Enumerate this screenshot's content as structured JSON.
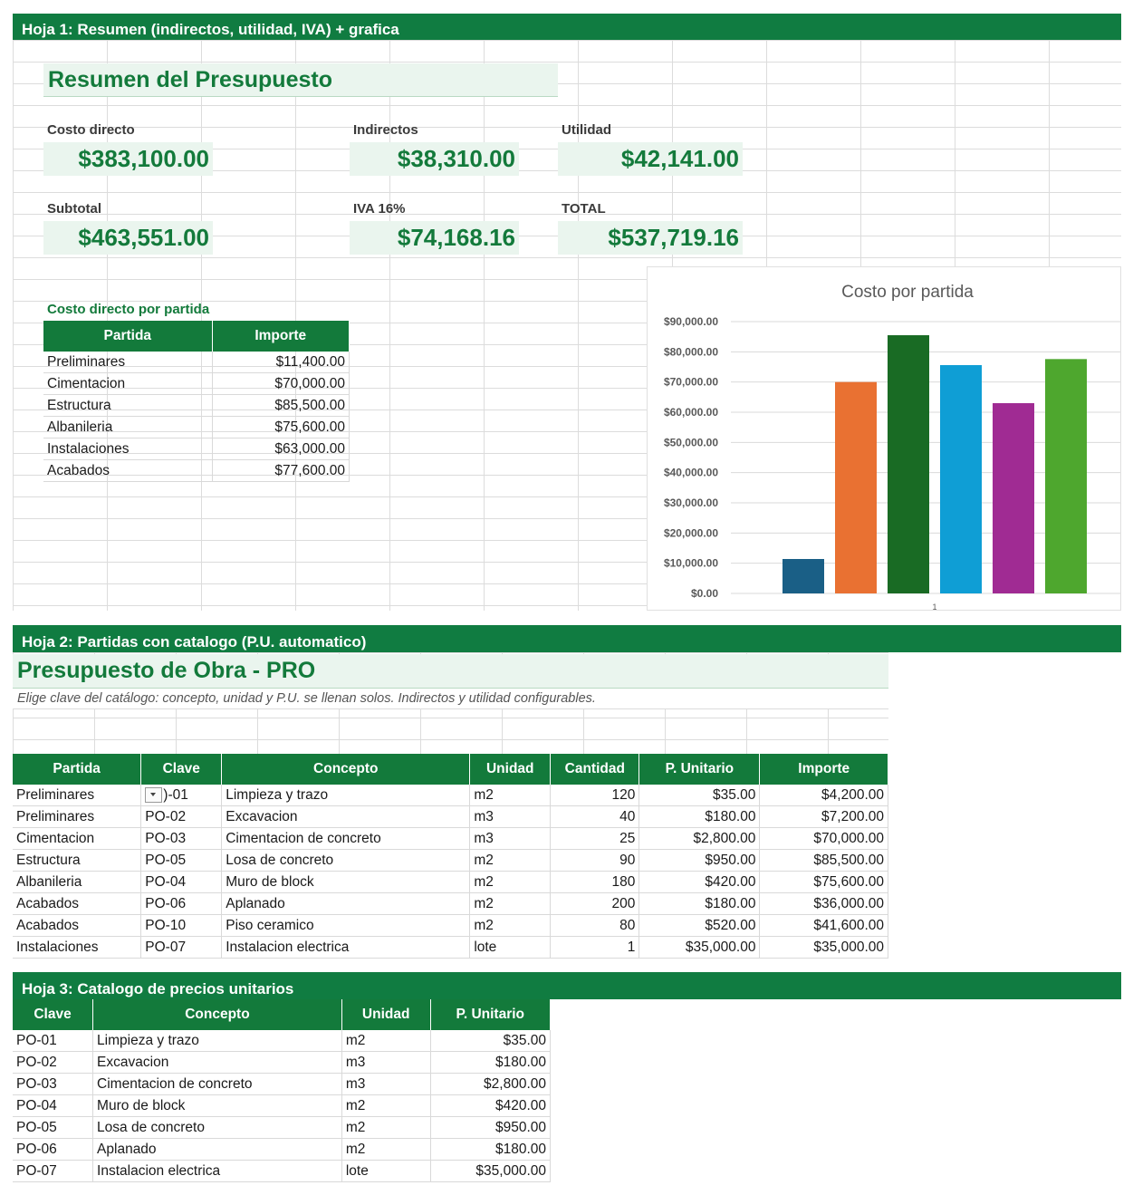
{
  "sheet1": {
    "band": "Hoja 1: Resumen (indirectos, utilidad, IVA) + grafica",
    "title": "Resumen del Presupuesto",
    "cards": [
      {
        "label": "Costo directo",
        "value": "$383,100.00"
      },
      {
        "label": "Indirectos",
        "value": "$38,310.00"
      },
      {
        "label": "Utilidad",
        "value": "$42,141.00"
      },
      {
        "label": "Subtotal",
        "value": "$463,551.00"
      },
      {
        "label": "IVA 16%",
        "value": "$74,168.16"
      },
      {
        "label": "TOTAL",
        "value": "$537,719.16"
      }
    ],
    "partida_title": "Costo directo por partida",
    "partida_headers": [
      "Partida",
      "Importe"
    ],
    "partidas": [
      [
        "Preliminares",
        "$11,400.00"
      ],
      [
        "Cimentacion",
        "$70,000.00"
      ],
      [
        "Estructura",
        "$85,500.00"
      ],
      [
        "Albanileria",
        "$75,600.00"
      ],
      [
        "Instalaciones",
        "$63,000.00"
      ],
      [
        "Acabados",
        "$77,600.00"
      ]
    ]
  },
  "chart_data": {
    "type": "bar",
    "title": "Costo por partida",
    "categories": [
      "1"
    ],
    "series": [
      {
        "values": [
          11400
        ],
        "color": "#1a5f86"
      },
      {
        "values": [
          70000
        ],
        "color": "#e97132"
      },
      {
        "values": [
          85500
        ],
        "color": "#196b24"
      },
      {
        "values": [
          75600
        ],
        "color": "#0f9ed5"
      },
      {
        "values": [
          63000
        ],
        "color": "#a02b93"
      },
      {
        "values": [
          77600
        ],
        "color": "#4ea72e"
      }
    ],
    "ylim": [
      0,
      90000
    ],
    "yticks": [
      "$0.00",
      "$10,000.00",
      "$20,000.00",
      "$30,000.00",
      "$40,000.00",
      "$50,000.00",
      "$60,000.00",
      "$70,000.00",
      "$80,000.00",
      "$90,000.00"
    ],
    "grid": true
  },
  "sheet2": {
    "band": "Hoja 2: Partidas con catalogo (P.U. automatico)",
    "title": "Presupuesto de Obra - PRO",
    "subtitle": "Elige clave del catálogo: concepto, unidad y P.U. se llenan solos. Indirectos y utilidad configurables.",
    "headers": [
      "Partida",
      "Clave",
      "Concepto",
      "Unidad",
      "Cantidad",
      "P. Unitario",
      "Importe"
    ],
    "rows": [
      [
        "Preliminares",
        ")-01",
        "Limpieza y trazo",
        "m2",
        "120",
        "$35.00",
        "$4,200.00"
      ],
      [
        "Preliminares",
        "PO-02",
        "Excavacion",
        "m3",
        "40",
        "$180.00",
        "$7,200.00"
      ],
      [
        "Cimentacion",
        "PO-03",
        "Cimentacion de concreto",
        "m3",
        "25",
        "$2,800.00",
        "$70,000.00"
      ],
      [
        "Estructura",
        "PO-05",
        "Losa de concreto",
        "m2",
        "90",
        "$950.00",
        "$85,500.00"
      ],
      [
        "Albanileria",
        "PO-04",
        "Muro de block",
        "m2",
        "180",
        "$420.00",
        "$75,600.00"
      ],
      [
        "Acabados",
        "PO-06",
        "Aplanado",
        "m2",
        "200",
        "$180.00",
        "$36,000.00"
      ],
      [
        "Acabados",
        "PO-10",
        "Piso ceramico",
        "m2",
        "80",
        "$520.00",
        "$41,600.00"
      ],
      [
        "Instalaciones",
        "PO-07",
        "Instalacion electrica",
        "lote",
        "1",
        "$35,000.00",
        "$35,000.00"
      ]
    ]
  },
  "sheet3": {
    "band": "Hoja 3: Catalogo de precios unitarios",
    "headers": [
      "Clave",
      "Concepto",
      "Unidad",
      "P. Unitario"
    ],
    "rows": [
      [
        "PO-01",
        "Limpieza y trazo",
        "m2",
        "$35.00"
      ],
      [
        "PO-02",
        "Excavacion",
        "m3",
        "$180.00"
      ],
      [
        "PO-03",
        "Cimentacion de concreto",
        "m3",
        "$2,800.00"
      ],
      [
        "PO-04",
        "Muro de block",
        "m2",
        "$420.00"
      ],
      [
        "PO-05",
        "Losa de concreto",
        "m2",
        "$950.00"
      ],
      [
        "PO-06",
        "Aplanado",
        "m2",
        "$180.00"
      ],
      [
        "PO-07",
        "Instalacion electrica",
        "lote",
        "$35,000.00"
      ]
    ]
  }
}
